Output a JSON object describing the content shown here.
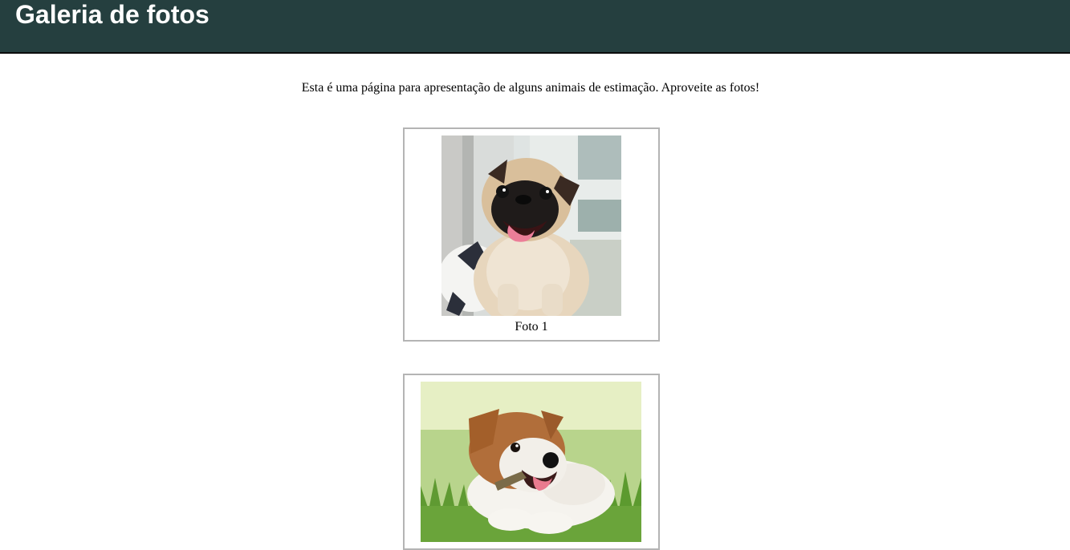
{
  "header": {
    "title": "Galeria de fotos",
    "background_color": "#253f3f"
  },
  "intro": {
    "text": "Esta é uma página para apresentação de alguns animais de estimação. Aproveite as fotos!"
  },
  "gallery": {
    "items": [
      {
        "caption": "Foto 1",
        "subject": "pug-puppy-photo"
      },
      {
        "caption": "",
        "subject": "jack-russell-puppy-photo"
      }
    ],
    "frame_border_color": "#b4b4b4"
  }
}
